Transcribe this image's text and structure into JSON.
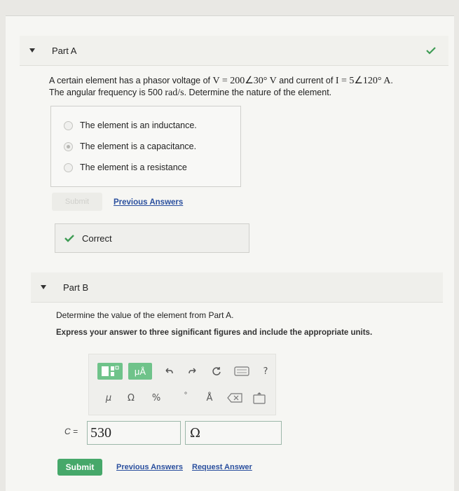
{
  "part_a": {
    "title": "Part A",
    "question_line1_pre": "A certain element has a phasor voltage of ",
    "voltage_expr": "V = 200∠30° V",
    "question_line1_mid": " and current of ",
    "current_expr": "I = 5∠120° A",
    "question_line1_end": ".",
    "question_line2_pre": "The angular frequency is 500 ",
    "freq_unit": "rad/s",
    "question_line2_end": ". Determine the nature of the element.",
    "options": [
      {
        "label": "The element is an inductance.",
        "selected": false
      },
      {
        "label": "The element is a capacitance.",
        "selected": true
      },
      {
        "label": "The element is a resistance",
        "selected": false
      }
    ],
    "submit_label": "Submit",
    "previous_answers_label": "Previous Answers",
    "feedback_label": "Correct"
  },
  "part_b": {
    "title": "Part B",
    "question": "Determine the value of the element from Part A.",
    "instruction": "Express your answer to three significant figures and include the appropriate units.",
    "toolbar": {
      "units_button": "μÅ",
      "mu_symbol": "μ",
      "omega_symbol": "Ω",
      "percent_symbol": "%",
      "degree_symbol": "°",
      "angstrom_symbol": "Å",
      "help_symbol": "?"
    },
    "answer_variable": "C =",
    "answer_value": "530",
    "answer_unit": "Ω",
    "submit_label": "Submit",
    "previous_answers_label": "Previous Answers",
    "request_answer_label": "Request Answer"
  },
  "colors": {
    "accent_green": "#46a86a",
    "link_blue": "#2a4f9e",
    "check_green": "#3f9c55"
  }
}
